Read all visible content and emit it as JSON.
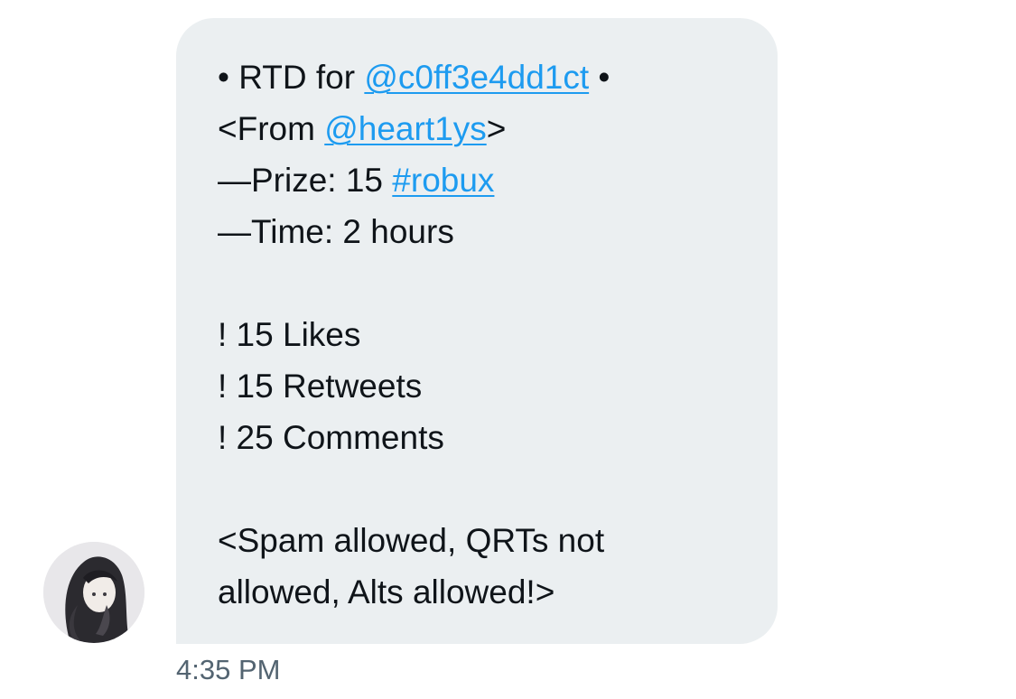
{
  "message": {
    "line1": {
      "prefix": "• RTD for ",
      "mention": "@c0ff3e4dd1ct",
      "suffix": " •"
    },
    "line2": {
      "prefix": "<From ",
      "mention": "@heart1ys",
      "suffix": ">"
    },
    "line3": {
      "prefix": "—Prize: 15 ",
      "hashtag": "#robux"
    },
    "line4": "—Time: 2 hours",
    "requirements": [
      "! 15 Likes",
      "! 15 Retweets",
      "! 25 Comments"
    ],
    "rules_line1": "<Spam allowed, QRTs not",
    "rules_line2": "allowed, Alts allowed!>"
  },
  "timestamp": "4:35 PM",
  "colors": {
    "bubble": "#ebeff1",
    "link": "#1d9bf0",
    "text": "#0f1419",
    "timestamp": "#536471"
  }
}
